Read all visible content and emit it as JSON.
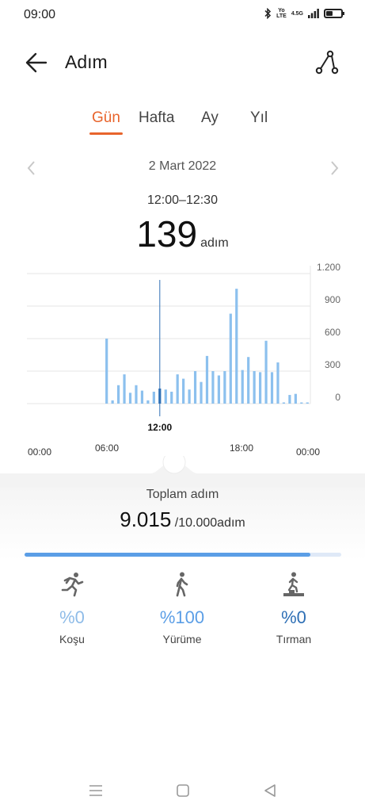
{
  "status_bar": {
    "time": "09:00",
    "signal_text_1": "Yo\nLTE",
    "signal_text_2": "4.5G",
    "icons": [
      "bluetooth-icon",
      "volte-icon",
      "signal-icon",
      "battery-icon"
    ]
  },
  "header": {
    "title": "Adım",
    "back_icon": "arrow-left-icon",
    "route_icon": "route-icon"
  },
  "tabs": {
    "items": [
      "Gün",
      "Hafta",
      "Ay",
      "Yıl"
    ],
    "active_index": 0,
    "active_color": "#e8642c"
  },
  "date_nav": {
    "date": "2 Mart 2022"
  },
  "selection": {
    "time_range": "12:00–12:30",
    "value": "139",
    "unit": "adım"
  },
  "chart_data": {
    "type": "bar",
    "y_ticks": [
      "1.200",
      "900",
      "600",
      "300",
      "0"
    ],
    "ylim": [
      0,
      1200
    ],
    "x_ticks": [
      "00:00",
      "06:00",
      "12:00",
      "18:00",
      "00:00"
    ],
    "selected_label": "12:00",
    "bar_color": "#8cc0ee",
    "selected_color": "#2e6fb5",
    "x": [
      "06:30",
      "07:00",
      "07:30",
      "08:00",
      "08:30",
      "09:00",
      "09:30",
      "10:00",
      "10:30",
      "11:00",
      "11:30",
      "12:00",
      "12:30",
      "13:00",
      "13:30",
      "14:00",
      "14:30",
      "15:00",
      "15:30",
      "16:00",
      "16:30",
      "17:00",
      "17:30",
      "18:00",
      "18:30",
      "19:00",
      "19:30",
      "20:00",
      "20:30",
      "21:00",
      "21:30",
      "22:00",
      "22:30",
      "23:00",
      "23:30"
    ],
    "values": [
      600,
      30,
      170,
      270,
      100,
      170,
      120,
      30,
      110,
      139,
      130,
      110,
      270,
      230,
      130,
      300,
      200,
      440,
      300,
      260,
      300,
      830,
      1060,
      310,
      430,
      300,
      290,
      580,
      290,
      380,
      0,
      80,
      90,
      0,
      0
    ],
    "selected_index": 9,
    "grid": true
  },
  "summary": {
    "label": "Toplam adım",
    "value": "9.015",
    "goal": "/10.000adım",
    "progress_fraction": 0.9015,
    "progress_color": "#5b9ee6"
  },
  "activities": [
    {
      "icon": "running-icon",
      "value": "%0",
      "label": "Koşu",
      "color": "#8fbce8"
    },
    {
      "icon": "walking-icon",
      "value": "%100",
      "label": "Yürüme",
      "color": "#5b9ee6"
    },
    {
      "icon": "climbing-icon",
      "value": "%0",
      "label": "Tırman",
      "color": "#2e6fb5"
    }
  ],
  "nav_bar": {
    "icons": [
      "menu-icon",
      "home-icon",
      "back-triangle-icon"
    ]
  }
}
